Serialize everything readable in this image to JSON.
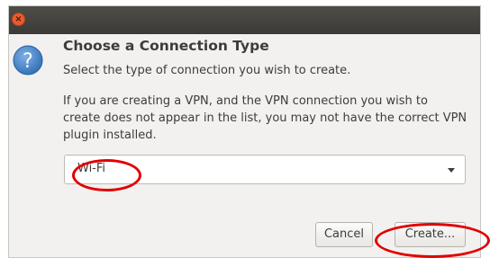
{
  "dialog": {
    "close_glyph": "×",
    "heading": "Choose a Connection Type",
    "subtitle": "Select the type of connection you wish to create.",
    "paragraph_lines": [
      "If you are creating a VPN, and the VPN connection you wish to",
      "create does not appear in the list, you may not have the correct VPN",
      "plugin installed."
    ],
    "connection_type": {
      "selected": "Wi-Fi"
    },
    "buttons": {
      "cancel_label": "Cancel",
      "create_label": "Create..."
    }
  },
  "icons": {
    "info": "question-icon",
    "dropdown": "chevron-down-icon",
    "close": "close-icon"
  },
  "colors": {
    "titlebar": "#3b3a36",
    "close_button": "#e95b2c",
    "info_icon": "#3f7fc4",
    "annotation": "#e00000",
    "dialog_bg": "#f2f1f0"
  }
}
